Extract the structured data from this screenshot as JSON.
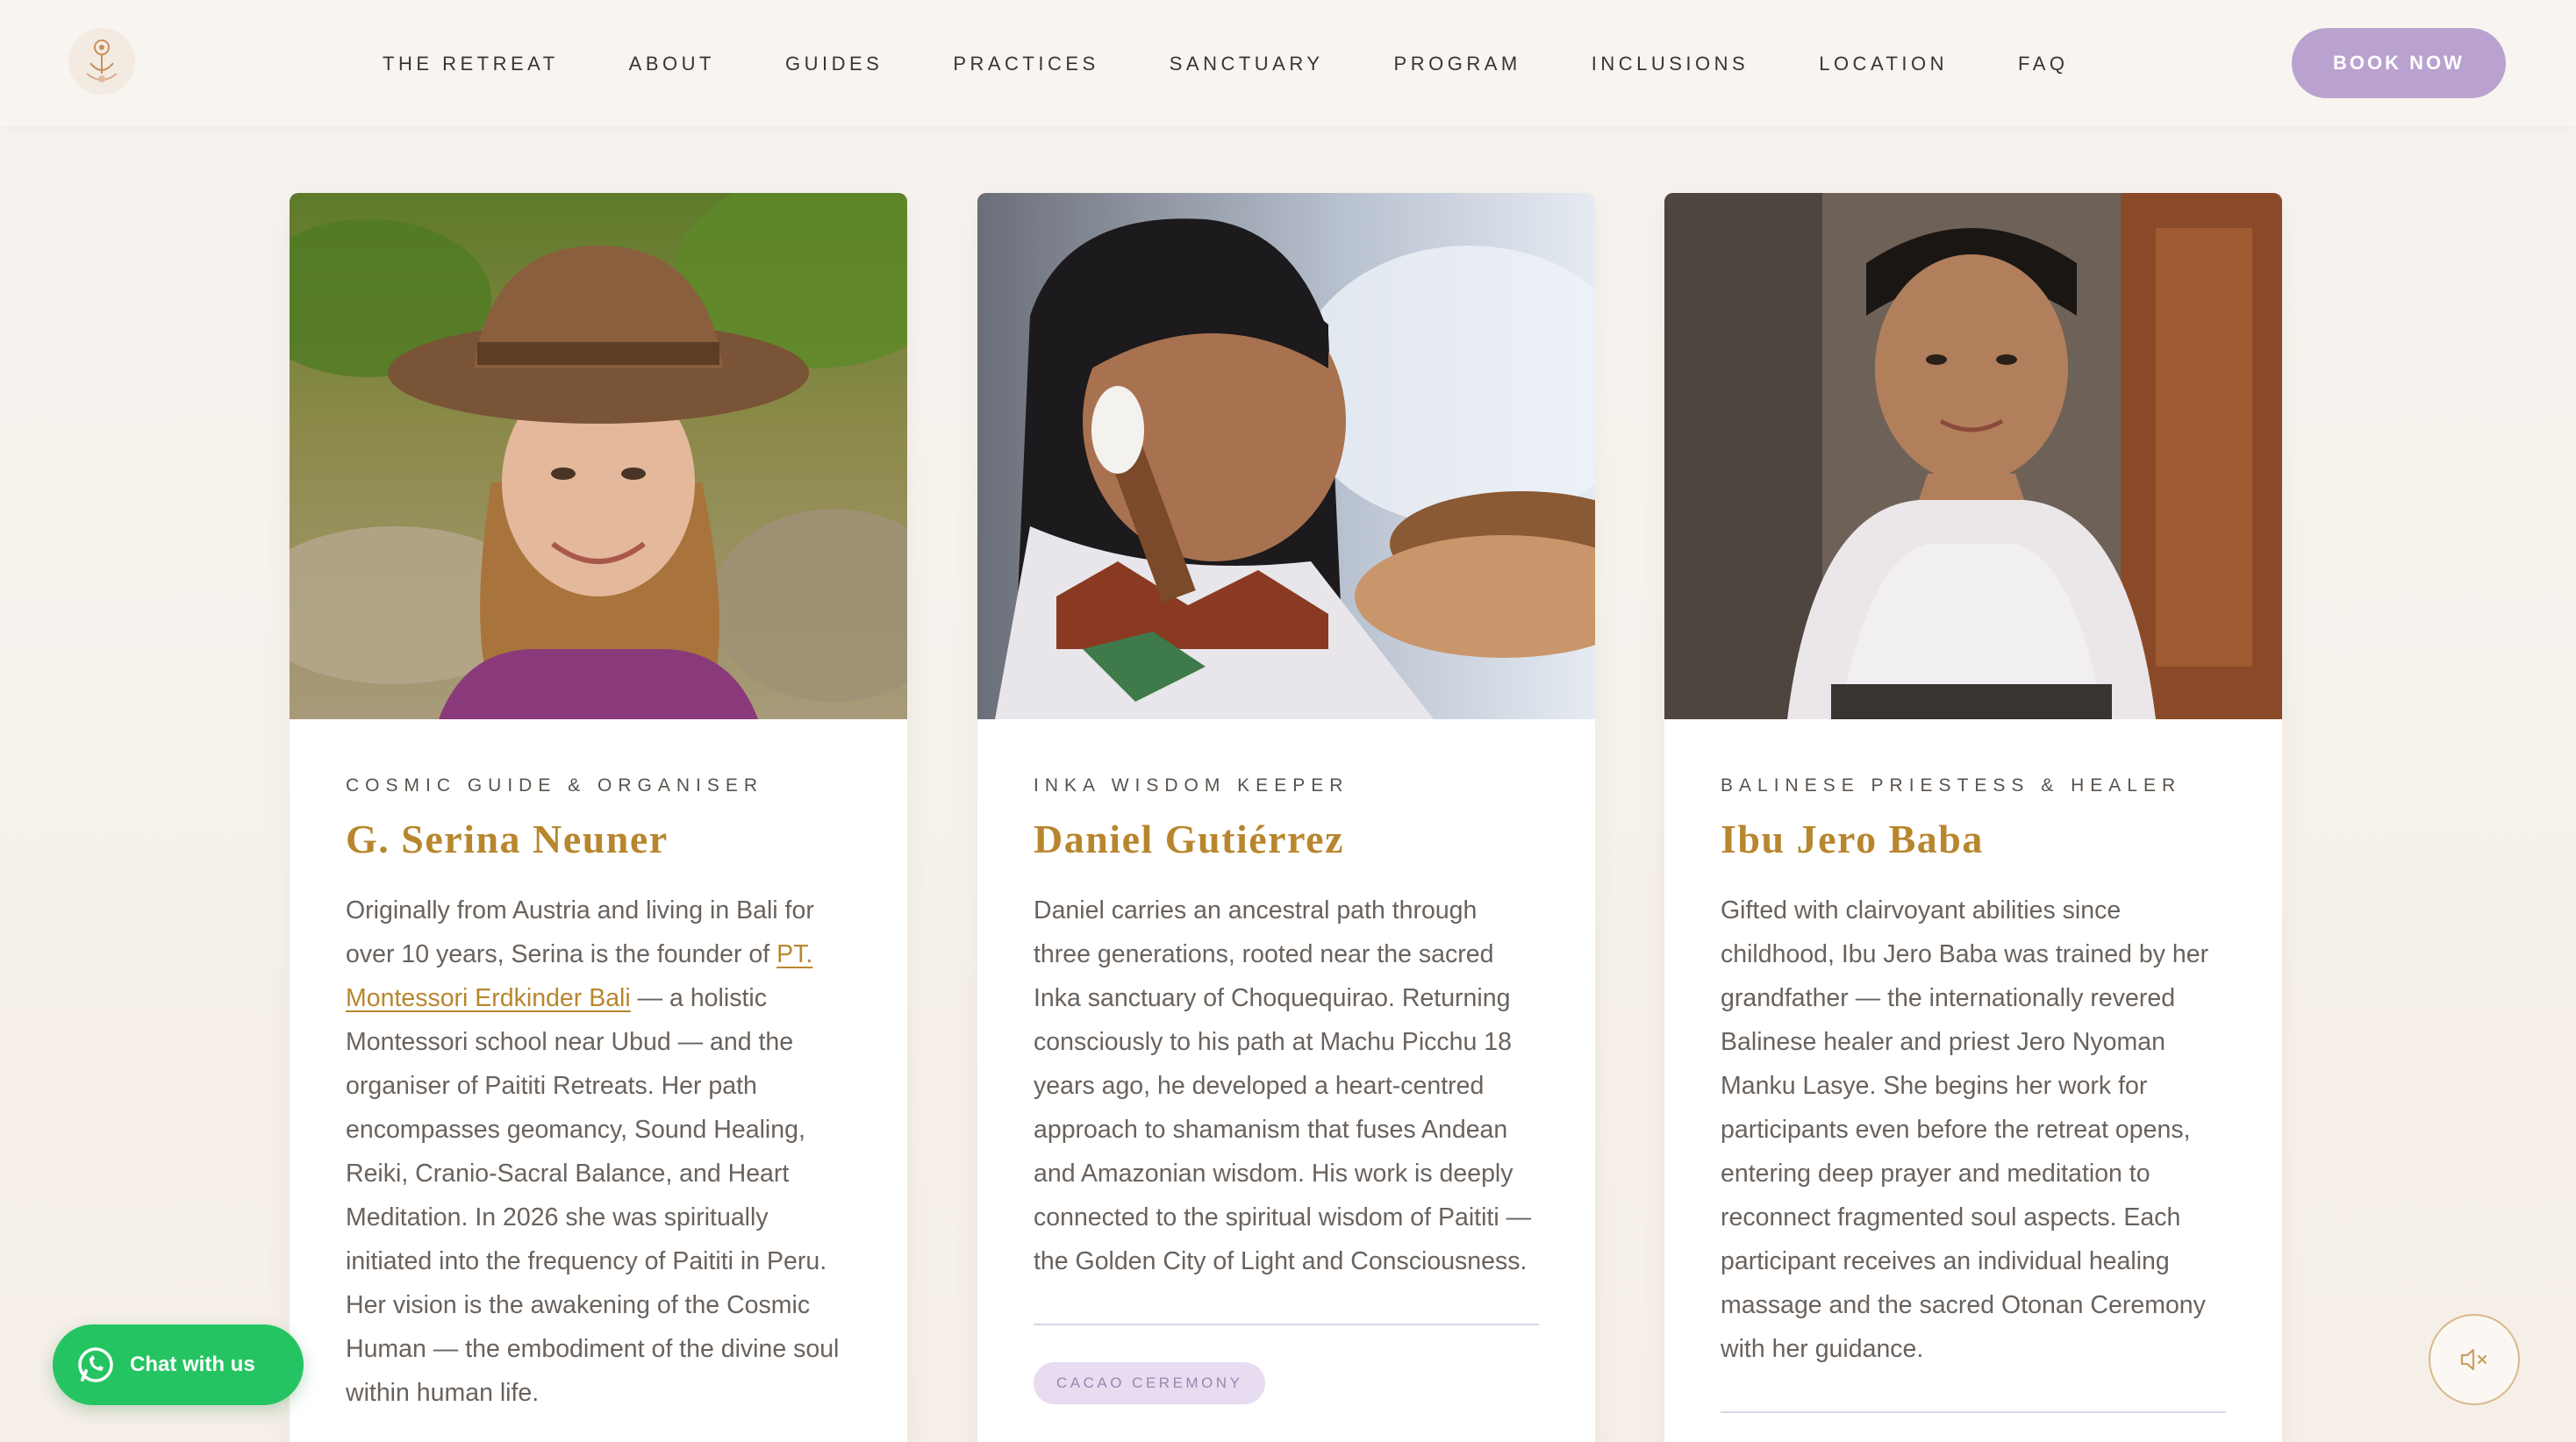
{
  "nav": {
    "items": [
      {
        "label": "THE RETREAT"
      },
      {
        "label": "ABOUT"
      },
      {
        "label": "GUIDES"
      },
      {
        "label": "PRACTICES"
      },
      {
        "label": "SANCTUARY"
      },
      {
        "label": "PROGRAM"
      },
      {
        "label": "INCLUSIONS"
      },
      {
        "label": "LOCATION"
      },
      {
        "label": "FAQ"
      }
    ],
    "book_label": "BOOK NOW"
  },
  "guides": [
    {
      "role": "COSMIC GUIDE & ORGANISER",
      "name": "G. Serina Neuner",
      "bio_before": "Originally from Austria and living in Bali for over 10 years, Serina is the founder of ",
      "bio_link": "PT. Montessori Erdkinder Bali",
      "bio_after": " — a holistic Montessori school near Ubud — and the organiser of Paititi Retreats. Her path encompasses geomancy, Sound Healing, Reiki, Cranio-Sacral Balance, and Heart Meditation. In 2026 she was spiritually initiated into the frequency of Paititi in Peru. Her vision is the awakening of the Cosmic Human — the embodiment of the divine soul within human life."
    },
    {
      "role": "INKA WISDOM KEEPER",
      "name": "Daniel Gutiérrez",
      "bio": "Daniel carries an ancestral path through three generations, rooted near the sacred Inka sanctuary of Choquequirao. Returning consciously to his path at Machu Picchu 18 years ago, he developed a heart-centred approach to shamanism that fuses Andean and Amazonian wisdom. His work is deeply connected to the spiritual wisdom of Paititi — the Golden City of Light and Consciousness.",
      "tag": "CACAO CEREMONY"
    },
    {
      "role": "BALINESE PRIESTESS & HEALER",
      "name": "Ibu Jero Baba",
      "bio": "Gifted with clairvoyant abilities since childhood, Ibu Jero Baba was trained by her grandfather — the internationally revered Balinese healer and priest Jero Nyoman Manku Lasye. She begins her work for participants even before the retreat opens, entering deep prayer and meditation to reconnect fragmented soul aspects. Each participant receives an individual healing massage and the sacred Otonan Ceremony with her guidance."
    }
  ],
  "chat": {
    "label": "Chat with us",
    "icon": "whatsapp-icon"
  },
  "sound": {
    "icon": "speaker-muted-icon"
  },
  "colors": {
    "accent": "#b8862e",
    "button": "#b9a2cf",
    "chat": "#25c462"
  }
}
